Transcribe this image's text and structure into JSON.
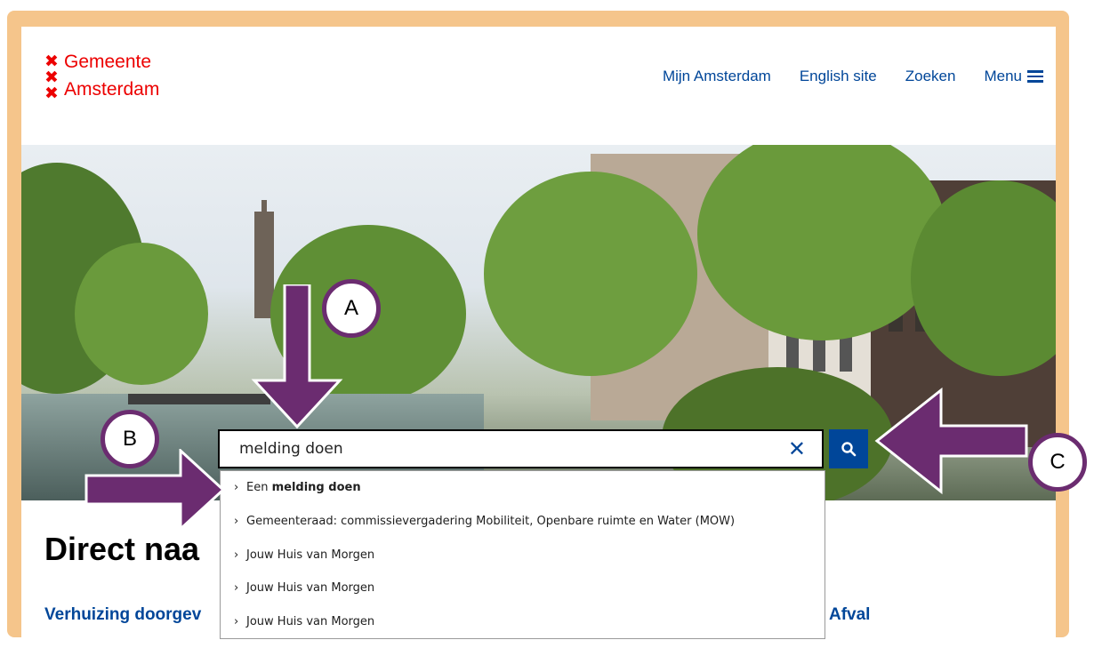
{
  "header": {
    "logo_line1": "Gemeente",
    "logo_line2": "Amsterdam",
    "logo_cross": "✖",
    "nav": [
      "Mijn Amsterdam",
      "English site",
      "Zoeken"
    ],
    "menu_label": "Menu"
  },
  "search": {
    "value": "melding doen",
    "clear_icon": "✕",
    "suggestions": [
      {
        "prefix": "Een ",
        "bold": "melding doen",
        "rest": ""
      },
      {
        "prefix": "Gemeenteraad: commissievergadering Mobiliteit, Openbare ruimte en Water (MOW)",
        "bold": "",
        "rest": ""
      },
      {
        "prefix": "Jouw Huis van Morgen",
        "bold": "",
        "rest": ""
      },
      {
        "prefix": "Jouw Huis van Morgen",
        "bold": "",
        "rest": ""
      },
      {
        "prefix": "Jouw Huis van Morgen",
        "bold": "",
        "rest": ""
      }
    ]
  },
  "content": {
    "heading": "Direct naa",
    "link_left": "Verhuizing doorgev",
    "link_right": "Afval"
  },
  "annotations": {
    "a": "A",
    "b": "B",
    "c": "C"
  },
  "colors": {
    "brand_red": "#ec0000",
    "link_blue": "#004699",
    "frame": "#f5c58b",
    "arrow": "#6b2c70"
  }
}
